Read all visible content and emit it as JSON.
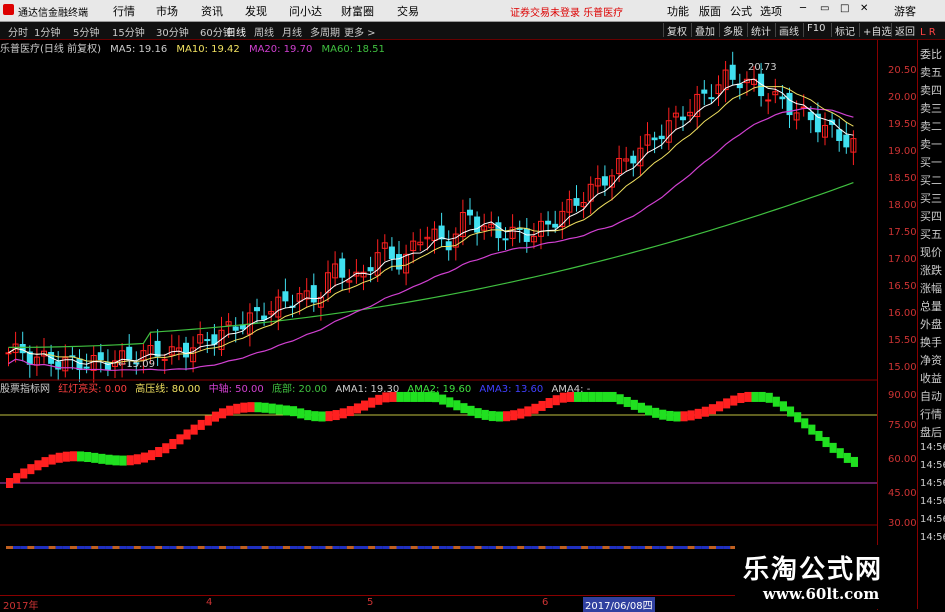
{
  "title_bar": {
    "app_name": "通达信金融终端",
    "menus": [
      "行情",
      "市场",
      "资讯",
      "发现",
      "问小达",
      "财富圈",
      "交易"
    ],
    "notice": "证券交易未登录",
    "stock": "乐普医疗",
    "right_buttons": [
      "功能",
      "版面",
      "公式",
      "选项"
    ],
    "guest": "游客"
  },
  "period_tabs": [
    "分时",
    "1分钟",
    "5分钟",
    "15分钟",
    "30分钟",
    "60分钟",
    "日线",
    "周线",
    "月线",
    "多周期",
    "更多 >"
  ],
  "active_tab": "日线",
  "toolbar_buttons": [
    "复权",
    "叠加",
    "多股",
    "统计",
    "画线",
    "F10",
    "标记",
    "+自选",
    "返回"
  ],
  "main_legend": {
    "name": "乐普医疗(日线 前复权)",
    "ma5": "MA5: 19.16",
    "ma10": "MA10: 19.42",
    "ma20": "MA20: 19.70",
    "ma60": "MA60: 18.51"
  },
  "price_axis": [
    "20.50",
    "20.00",
    "19.50",
    "19.00",
    "18.50",
    "18.00",
    "17.50",
    "17.00",
    "16.50",
    "16.00",
    "15.50",
    "15.00"
  ],
  "annotations": {
    "high": "20.73",
    "low": "←15.09"
  },
  "sub_legend": {
    "name": "股票指标网",
    "hongdeng": "红灯亮买: 0.00",
    "gaoya": "高压线: 80.00",
    "zhongzhou": "中轴: 50.00",
    "diwu": "底部: 20.00",
    "ama1": "AMA1: 19.30",
    "ama2": "AMA2: 19.60",
    "ama3": "AMA3: 13.60",
    "ama4": "AMA4: -"
  },
  "sub_axis": [
    "90.00",
    "75.00",
    "60.00",
    "45.00",
    "30.00"
  ],
  "x_axis": [
    "2017年",
    "4",
    "5",
    "6",
    "2017/06/08四"
  ],
  "right_panel": [
    "委比",
    "卖五",
    "卖四",
    "卖三",
    "卖二",
    "卖一",
    "买一",
    "买二",
    "买三",
    "买四",
    "买五",
    "现价",
    "涨跌",
    "涨幅",
    "总量",
    "外盘",
    "换手",
    "净资",
    "收益",
    "自动",
    "行情",
    "盘后",
    "14:56",
    "14:56",
    "14:56",
    "14:56",
    "14:56",
    "14:56"
  ],
  "right_panel_top": "L R",
  "watermark": {
    "name": "乐淘公式网",
    "url": "www.60lt.com"
  },
  "colors": {
    "up": "#ff2020",
    "down": "#40e0f0",
    "ma5": "#ffffff",
    "ma10": "#f0e060",
    "ma20": "#d040d0",
    "ma60": "#40c040"
  }
}
